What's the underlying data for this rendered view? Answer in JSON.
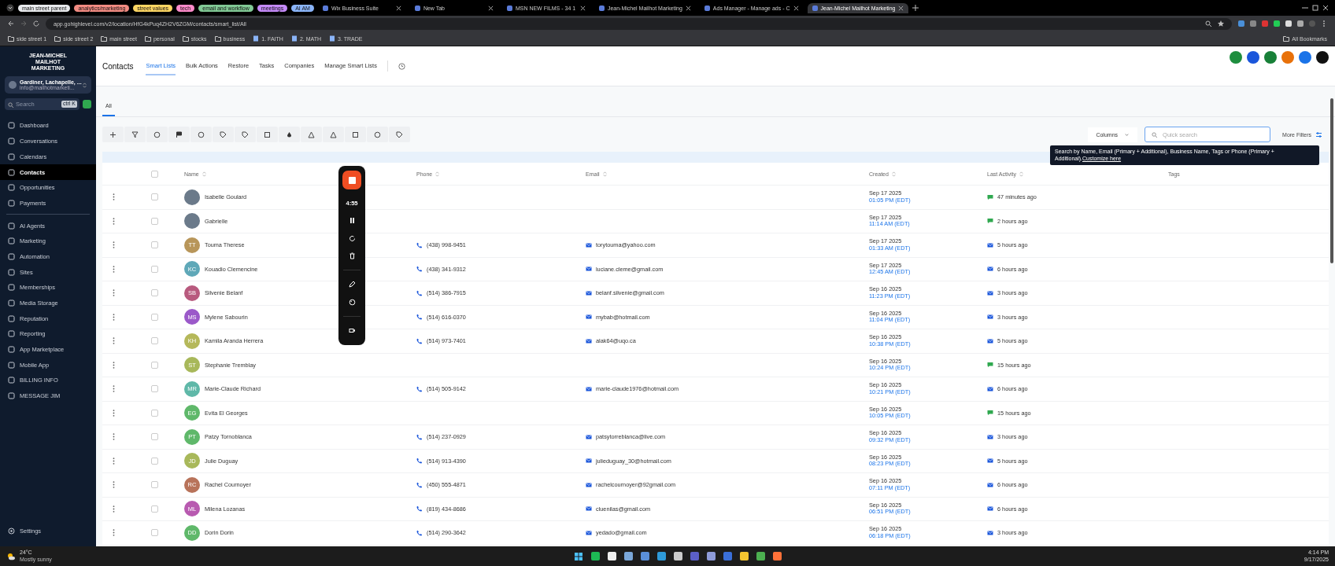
{
  "browser": {
    "tab_groups": [
      {
        "label": "main street parent",
        "color": "#e8eaed"
      },
      {
        "label": "analytics/marketing",
        "color": "#f28b82"
      },
      {
        "label": "street values",
        "color": "#fdd663"
      },
      {
        "label": "tech",
        "color": "#ff8bcb"
      },
      {
        "label": "email and workflow",
        "color": "#81c995"
      },
      {
        "label": "meetings",
        "color": "#c58af9"
      },
      {
        "label": "AI AM",
        "color": "#8ab4f8"
      }
    ],
    "tabs": [
      {
        "title": "Wix Business Suite",
        "selected": false
      },
      {
        "title": "New Tab",
        "selected": false
      },
      {
        "title": "MSN NEW FILMS - 34 1",
        "selected": false
      },
      {
        "title": "Jean-Michel Mailhot Marketing",
        "selected": false
      },
      {
        "title": "Ads Manager - Manage ads - C",
        "selected": false
      },
      {
        "title": "Jean-Michel Mailhot Marketing",
        "selected": true
      }
    ],
    "url": "app.gohighlevel.com/v2/location/HfG4kPuq4ZH2V6ZGM/contacts/smart_list/All",
    "bookmarks": [
      {
        "label": "side street 1",
        "kind": "folder"
      },
      {
        "label": "side street 2",
        "kind": "folder"
      },
      {
        "label": "main street",
        "kind": "folder"
      },
      {
        "label": "personal",
        "kind": "folder"
      },
      {
        "label": "stocks",
        "kind": "folder"
      },
      {
        "label": "business",
        "kind": "folder"
      },
      {
        "label": "1. FAITH",
        "kind": "page"
      },
      {
        "label": "2. MATH",
        "kind": "page"
      },
      {
        "label": "3. TRADE",
        "kind": "page"
      }
    ],
    "all_bookmarks": "All Bookmarks"
  },
  "sidebar": {
    "logo": "JEAN-MICHEL MAILHOT MARKETING",
    "account": {
      "name": "Gardiner, Lachapelle, ...",
      "email": "info@mailhotmarketi..."
    },
    "search": {
      "placeholder": "Search",
      "shortcut": "ctrl K"
    },
    "items": [
      {
        "label": "Dashboard",
        "selected": false
      },
      {
        "label": "Conversations",
        "selected": false
      },
      {
        "label": "Calendars",
        "selected": false
      },
      {
        "label": "Contacts",
        "selected": true
      },
      {
        "label": "Opportunities",
        "selected": false
      },
      {
        "label": "Payments",
        "selected": false
      }
    ],
    "items_2": [
      {
        "label": "AI Agents",
        "selected": false
      },
      {
        "label": "Marketing",
        "selected": false
      },
      {
        "label": "Automation",
        "selected": false
      },
      {
        "label": "Sites",
        "selected": false
      },
      {
        "label": "Memberships",
        "selected": false
      },
      {
        "label": "Media Storage",
        "selected": false
      },
      {
        "label": "Reputation",
        "selected": false
      },
      {
        "label": "Reporting",
        "selected": false
      },
      {
        "label": "App Marketplace",
        "selected": false
      },
      {
        "label": "Mobile App",
        "selected": false
      },
      {
        "label": "BILLING INFO",
        "selected": false
      },
      {
        "label": "MESSAGE JIM",
        "selected": false
      }
    ],
    "settings": "Settings"
  },
  "header": {
    "title": "Contacts",
    "tabs": [
      {
        "label": "Smart Lists",
        "selected": true
      },
      {
        "label": "Bulk Actions",
        "selected": false
      },
      {
        "label": "Restore",
        "selected": false
      },
      {
        "label": "Tasks",
        "selected": false
      },
      {
        "label": "Companies",
        "selected": false
      },
      {
        "label": "Manage Smart Lists",
        "selected": false
      }
    ],
    "quick_actions": [
      {
        "color": "#1e8e3e"
      },
      {
        "color": "#1a56db"
      },
      {
        "color": "#188038"
      },
      {
        "color": "#e8710a"
      },
      {
        "color": "#1a73e8"
      },
      {
        "color": "#111111"
      }
    ]
  },
  "list_tabs": [
    {
      "label": "All",
      "selected": true
    }
  ],
  "toolbar": [
    {
      "kind": "plus"
    },
    {
      "kind": "funnel"
    },
    {
      "kind": "circle"
    },
    {
      "kind": "flag"
    },
    {
      "kind": "circle"
    },
    {
      "kind": "tag"
    },
    {
      "kind": "tag"
    },
    {
      "kind": "square"
    },
    {
      "kind": "drop"
    },
    {
      "kind": "triangle"
    },
    {
      "kind": "triangle"
    },
    {
      "kind": "square"
    },
    {
      "kind": "circle"
    },
    {
      "kind": "tag"
    }
  ],
  "columns_button": "Columns",
  "search": {
    "placeholder": "Quick search"
  },
  "more_filters": "More Filters",
  "tooltip": {
    "text": "Search by Name, Email (Primary + Additional), Business Name, Tags or Phone (Primary + Additional).",
    "link": "Customize here"
  },
  "table": {
    "all_checked": false,
    "columns": [
      {
        "label": "Name",
        "sortable": true
      },
      {
        "label": "Phone",
        "sortable": true
      },
      {
        "label": "Email",
        "sortable": true
      },
      {
        "label": "Created",
        "sortable": true
      },
      {
        "label": "Last Activity",
        "sortable": true
      },
      {
        "label": "Tags",
        "sortable": false
      }
    ],
    "rows": [
      {
        "avatar": {
          "kind": "photo"
        },
        "name": "Isabelle Goulard",
        "checked": false,
        "created": "Sep 17 2025",
        "time": "01:05 PM (EDT)",
        "activity": {
          "kind": "sms",
          "text": "47 minutes ago"
        }
      },
      {
        "avatar": {
          "kind": "photo"
        },
        "name": "Gabrielle",
        "checked": false,
        "created": "Sep 17 2025",
        "time": "11:14 AM (EDT)",
        "activity": {
          "kind": "sms",
          "text": "2 hours ago"
        }
      },
      {
        "avatar": {
          "kind": "initials",
          "initials": "TT",
          "color": "#b8965a"
        },
        "name": "Touma Therese",
        "checked": false,
        "phone": "(438) 998-9451",
        "email": "torytouma@yahoo.com",
        "created": "Sep 17 2025",
        "time": "01:33 AM (EDT)",
        "activity": {
          "kind": "email",
          "text": "5 hours ago"
        }
      },
      {
        "avatar": {
          "kind": "initials",
          "initials": "KC",
          "color": "#5fa8b8"
        },
        "name": "Kouadio Clemencine",
        "checked": false,
        "phone": "(438) 341-9312",
        "email": "luciane.cleme@gmail.com",
        "created": "Sep 17 2025",
        "time": "12:45 AM (EDT)",
        "activity": {
          "kind": "email",
          "text": "6 hours ago"
        }
      },
      {
        "avatar": {
          "kind": "initials",
          "initials": "SB",
          "color": "#b85a7e"
        },
        "name": "Silvenie Belanf",
        "checked": false,
        "phone": "(514) 386-7915",
        "email": "belanf.silvenie@gmail.com",
        "created": "Sep 16 2025",
        "time": "11:23 PM (EDT)",
        "activity": {
          "kind": "email",
          "text": "3 hours ago"
        }
      },
      {
        "avatar": {
          "kind": "initials",
          "initials": "MS",
          "color": "#9b59c9"
        },
        "name": "Mylene Sabourin",
        "checked": false,
        "phone": "(514) 616-0370",
        "email": "mybab@hotmail.com",
        "created": "Sep 16 2025",
        "time": "11:04 PM (EDT)",
        "activity": {
          "kind": "email",
          "text": "3 hours ago"
        }
      },
      {
        "avatar": {
          "kind": "initials",
          "initials": "KH",
          "color": "#b5b85a"
        },
        "name": "Kamila Aranda Herrera",
        "checked": false,
        "phone": "(514) 973-7401",
        "email": "alak64@uqo.ca",
        "created": "Sep 16 2025",
        "time": "10:38 PM (EDT)",
        "activity": {
          "kind": "email",
          "text": "5 hours ago"
        }
      },
      {
        "avatar": {
          "kind": "initials",
          "initials": "ST",
          "color": "#a8b85a"
        },
        "name": "Stephanie Tremblay",
        "checked": false,
        "created": "Sep 16 2025",
        "time": "10:24 PM (EDT)",
        "activity": {
          "kind": "sms",
          "text": "15 hours ago"
        }
      },
      {
        "avatar": {
          "kind": "initials",
          "initials": "MR",
          "color": "#5fb8a8"
        },
        "name": "Marie-Claude Richard",
        "checked": false,
        "phone": "(514) 505-9142",
        "email": "marie-claude1976@hotmail.com",
        "created": "Sep 16 2025",
        "time": "10:21 PM (EDT)",
        "activity": {
          "kind": "email",
          "text": "6 hours ago"
        }
      },
      {
        "avatar": {
          "kind": "initials",
          "initials": "EG",
          "color": "#5fb86a"
        },
        "name": "Evita El Georges",
        "checked": false,
        "created": "Sep 16 2025",
        "time": "10:05 PM (EDT)",
        "activity": {
          "kind": "sms",
          "text": "15 hours ago"
        }
      },
      {
        "avatar": {
          "kind": "initials",
          "initials": "PT",
          "color": "#5fb86a"
        },
        "name": "Patzy Tornoblanca",
        "checked": false,
        "phone": "(514) 237-0929",
        "email": "patsytorreblanca@live.com",
        "created": "Sep 16 2025",
        "time": "09:32 PM (EDT)",
        "activity": {
          "kind": "email",
          "text": "3 hours ago"
        }
      },
      {
        "avatar": {
          "kind": "initials",
          "initials": "JD",
          "color": "#a8b85a"
        },
        "name": "Julie Duguay",
        "checked": false,
        "phone": "(514) 913-4390",
        "email": "julieduguay_30@hotmail.com",
        "created": "Sep 16 2025",
        "time": "08:23 PM (EDT)",
        "activity": {
          "kind": "email",
          "text": "5 hours ago"
        }
      },
      {
        "avatar": {
          "kind": "initials",
          "initials": "RC",
          "color": "#b8735a"
        },
        "name": "Rachel Cournoyer",
        "checked": false,
        "phone": "(450) 555-4871",
        "email": "rachelcournoyer@92gmail.com",
        "created": "Sep 16 2025",
        "time": "07:11 PM (EDT)",
        "activity": {
          "kind": "email",
          "text": "6 hours ago"
        }
      },
      {
        "avatar": {
          "kind": "initials",
          "initials": "ML",
          "color": "#b85ab0"
        },
        "name": "Milena Lozanas",
        "checked": false,
        "phone": "(819) 434-8686",
        "email": "cluenilas@gmail.com",
        "created": "Sep 16 2025",
        "time": "06:51 PM (EDT)",
        "activity": {
          "kind": "email",
          "text": "6 hours ago"
        }
      },
      {
        "avatar": {
          "kind": "initials",
          "initials": "DD",
          "color": "#5fb86a"
        },
        "name": "Dorin Dorin",
        "checked": false,
        "phone": "(514) 290-3642",
        "email": "yedado@gmail.com",
        "created": "Sep 16 2025",
        "time": "06:18 PM (EDT)",
        "activity": {
          "kind": "email",
          "text": "3 hours ago"
        }
      }
    ]
  },
  "recorder": {
    "timer": "4:55"
  },
  "taskbar": {
    "weather": {
      "temp": "24°C",
      "text": "Mostly sunny"
    },
    "time": "4:14 PM",
    "date": "9/17/2025"
  }
}
